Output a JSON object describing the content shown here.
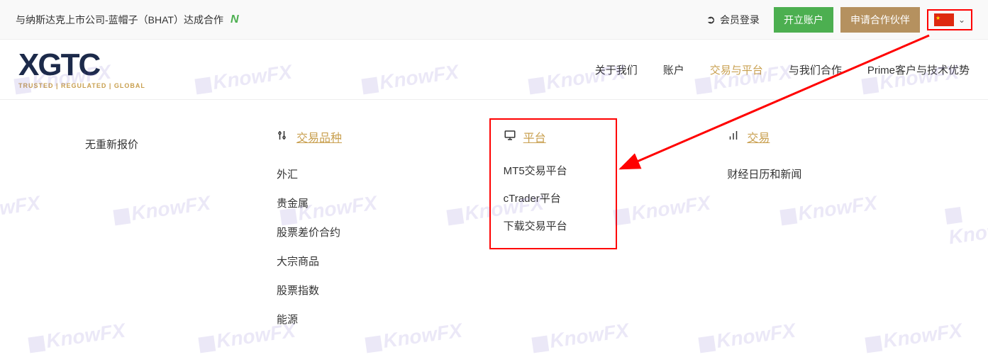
{
  "topbar": {
    "announcement": "与纳斯达克上市公司-蓝帽子（BHAT）达成合作",
    "login_label": "会员登录",
    "open_account_label": "开立账户",
    "partner_label": "申请合作伙伴"
  },
  "logo": {
    "main": "XGTC",
    "sub": "TRUSTED | REGULATED | GLOBAL"
  },
  "nav": {
    "about": "关于我们",
    "account": "账户",
    "trading_platform": "交易与平台",
    "partner": "与我们合作",
    "prime": "Prime客户与技术优势"
  },
  "mega": {
    "no_requote": "无重新报价",
    "col_products": {
      "heading": "交易品种",
      "items": [
        "外汇",
        "贵金属",
        "股票差价合约",
        "大宗商品",
        "股票指数",
        "能源"
      ]
    },
    "col_platform": {
      "heading": "平台",
      "items": [
        "MT5交易平台",
        "cTrader平台",
        "下载交易平台"
      ]
    },
    "col_trade": {
      "heading": "交易",
      "items": [
        "财经日历和新闻"
      ]
    }
  },
  "watermark_text": "KnowFX"
}
